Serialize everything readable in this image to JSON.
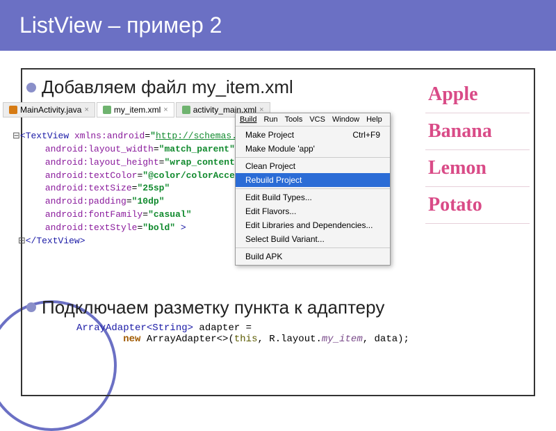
{
  "title": "ListView – пример 2",
  "bullet1": "Добавляем файл my_item.xml",
  "bullet2": "Подключаем разметку пункта к адаптеру",
  "tabs": {
    "t0": "MainActivity.java",
    "t1": "my_item.xml",
    "t2": "activity_main.xml"
  },
  "xml": {
    "open": "<TextView",
    "ns": "xmlns:android",
    "nsval": "http://schemas.android.com/apk/res/android",
    "a1": "android:layout_width",
    "v1": "match_parent",
    "a2": "android:layout_height",
    "v2": "wrap_content",
    "a3": "android:textColor",
    "v3": "@color/colorAccent",
    "a4": "android:textSize",
    "v4": "25sp",
    "a5": "android:padding",
    "v5": "10dp",
    "a6": "android:fontFamily",
    "v6": "casual",
    "a7": "android:textStyle",
    "v7": "bold",
    "close": "</TextView>"
  },
  "menubar": {
    "m0": "Build",
    "m1": "Run",
    "m2": "Tools",
    "m3": "VCS",
    "m4": "Window",
    "m5": "Help"
  },
  "menu": {
    "i0": "Make Project",
    "i0s": "Ctrl+F9",
    "i1": "Make Module 'app'",
    "i2": "Clean Project",
    "i3": "Rebuild Project",
    "i4": "Edit Build Types...",
    "i5": "Edit Flavors...",
    "i6": "Edit Libraries and Dependencies...",
    "i7": "Select Build Variant...",
    "i8": "Build APK"
  },
  "fruits": {
    "f0": "Apple",
    "f1": "Banana",
    "f2": "Lemon",
    "f3": "Potato"
  },
  "adapter": {
    "l1a": "ArrayAdapter<String>",
    "l1b": " adapter =",
    "l2a": "new",
    "l2b": " ArrayAdapter<>",
    "l2c": "(",
    "l2d": "this",
    "l2e": ", R.layout.",
    "l2f": "my_item",
    "l2g": ", data);"
  }
}
